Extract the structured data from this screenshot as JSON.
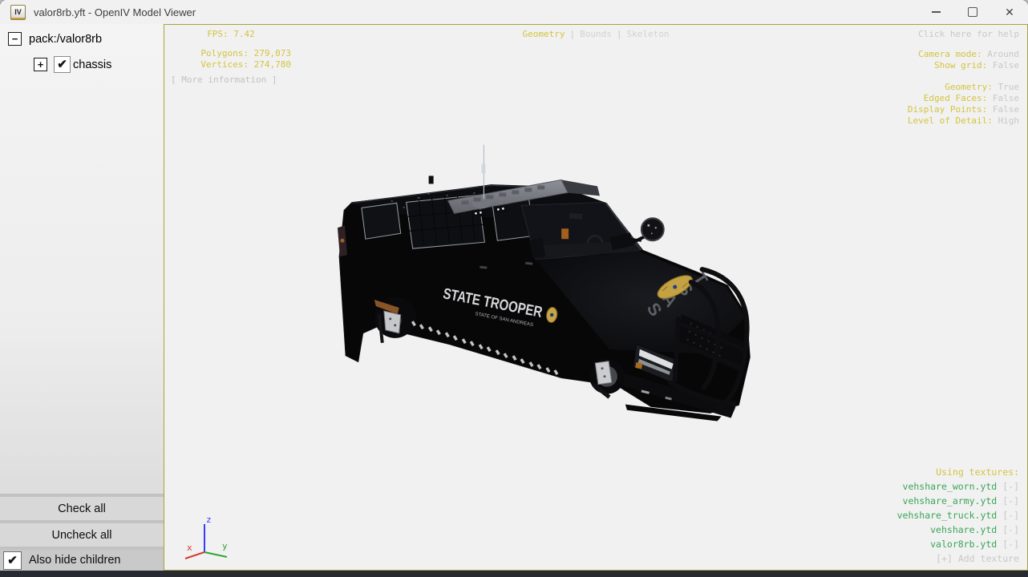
{
  "window": {
    "title": "valor8rb.yft - OpenIV Model Viewer",
    "icon_text": "IV"
  },
  "sidebar": {
    "tree": {
      "root_toggle": "−",
      "root_label": "pack:/valor8rb",
      "child_toggle": "+",
      "child_check": "✔",
      "child_label": "chassis"
    },
    "check_all": "Check all",
    "uncheck_all": "Uncheck all",
    "also_hide": {
      "check": "✔",
      "label": "Also hide children"
    }
  },
  "viewport": {
    "stats": {
      "fps": "FPS: 7.42",
      "polygons": "Polygons: 279,073",
      "vertices": "Vertices: 274,780",
      "more": "[ More information ]"
    },
    "tabs": [
      {
        "label": "Geometry",
        "active": true
      },
      {
        "label": "Bounds",
        "active": false
      },
      {
        "label": "Skeleton",
        "active": false
      }
    ],
    "tab_separator": "|",
    "help": "Click here for help",
    "settings": {
      "camera": [
        {
          "label": "Camera mode:",
          "value": "Around"
        },
        {
          "label": "Show grid:",
          "value": "False"
        }
      ],
      "render": [
        {
          "label": "Geometry:",
          "value": "True"
        },
        {
          "label": "Edged Faces:",
          "value": "False"
        },
        {
          "label": "Display Points:",
          "value": "False"
        },
        {
          "label": "Level of Detail:",
          "value": "High"
        }
      ]
    },
    "textures": {
      "header": "Using textures:",
      "items": [
        "vehshare_worn.ytd",
        "vehshare_army.ytd",
        "vehshare_truck.ytd",
        "vehshare.ytd",
        "valor8rb.ytd"
      ],
      "remove_label": "[-]",
      "add_label": "[+] Add texture"
    },
    "axis": {
      "x": "x",
      "y": "y",
      "z": "z"
    }
  },
  "model": {
    "door_text": "STATE TROOPER",
    "door_subtext": "STATE OF SAN ANDREAS",
    "hood_text": "SAST"
  },
  "colors": {
    "accent_yellow": "#d3c440",
    "value_gray": "#c8c8c8",
    "texture_green": "#3ba559",
    "axis_x": "#d03a2e",
    "axis_y": "#2aa832",
    "axis_z": "#3b3bff",
    "viewport_border": "#a6a33e"
  }
}
